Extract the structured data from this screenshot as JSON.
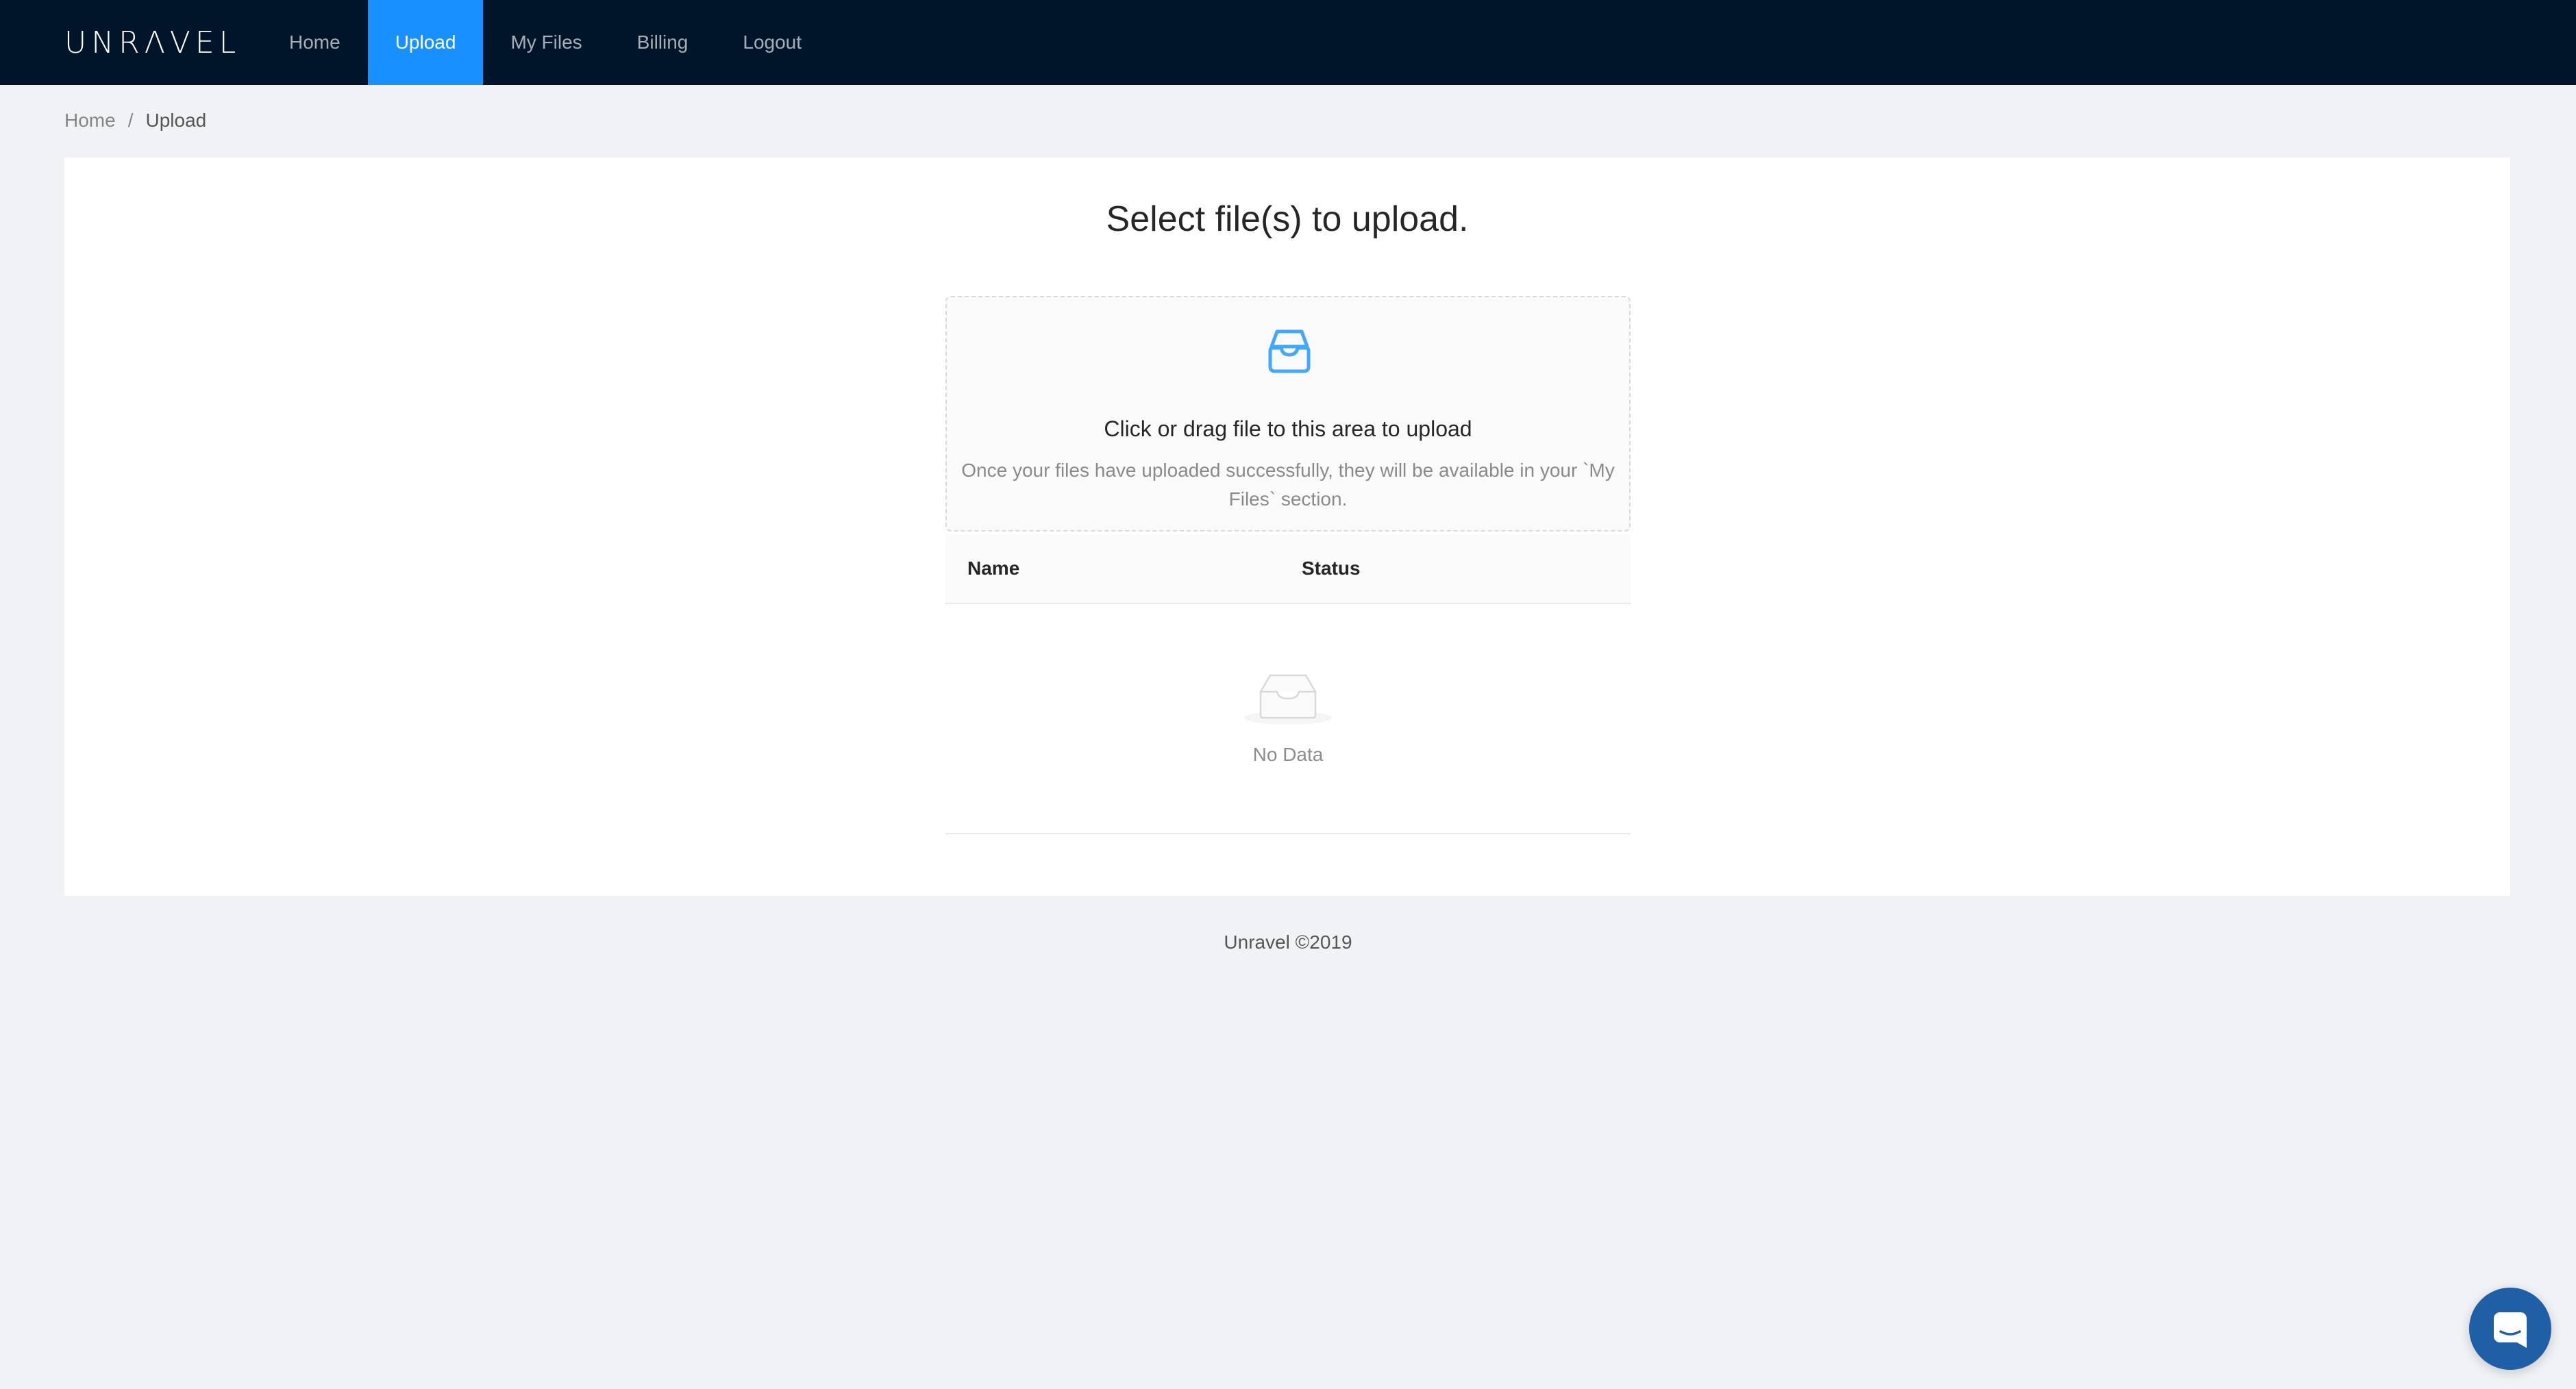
{
  "header": {
    "logo": "UNRΛVEL",
    "nav": [
      {
        "label": "Home"
      },
      {
        "label": "Upload",
        "active": true
      },
      {
        "label": "My Files"
      },
      {
        "label": "Billing"
      },
      {
        "label": "Logout"
      }
    ]
  },
  "breadcrumb": {
    "home": "Home",
    "separator": "/",
    "current": "Upload"
  },
  "main": {
    "title": "Select file(s) to upload.",
    "dropzone": {
      "icon": "inbox-icon",
      "text": "Click or drag file to this area to upload",
      "hint": "Once your files have uploaded successfully, they will be available in your `My Files` section."
    },
    "table": {
      "columns": [
        "Name",
        "Status"
      ],
      "rows": [],
      "empty_icon": "empty-inbox-icon",
      "empty_text": "No Data"
    }
  },
  "footer": {
    "text": "Unravel ©2019"
  },
  "chat_launcher": {
    "icon": "chat-icon"
  },
  "colors": {
    "header_bg": "#001529",
    "accent": "#1890ff",
    "page_bg": "#f0f2f5",
    "chat_bg": "#1f5fa6"
  }
}
